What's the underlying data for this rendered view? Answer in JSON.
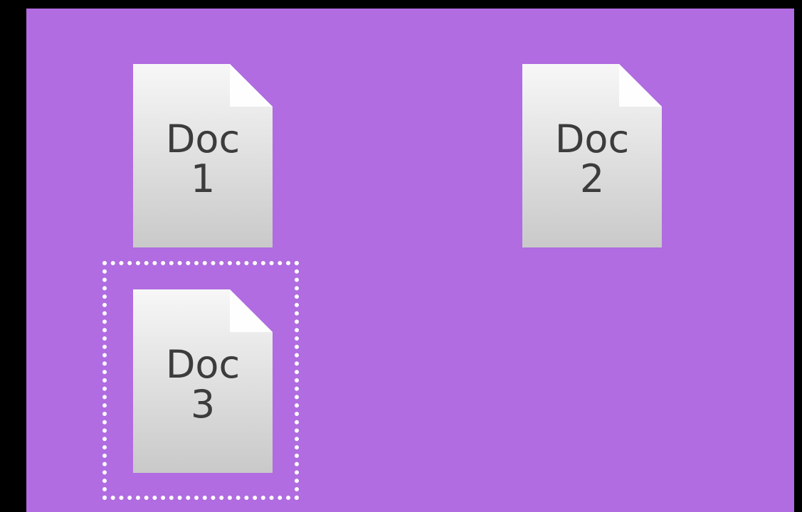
{
  "colors": {
    "background": "#000000",
    "desktop": "#b06ce0",
    "file_page_top": "#f7f7f7",
    "file_page_bottom": "#c9c9c9",
    "label_text": "#3c3c3c",
    "selection": "#ffffff"
  },
  "files": [
    {
      "name": "document-icon",
      "line1": "Doc",
      "line2": "1",
      "selected": false
    },
    {
      "name": "document-icon",
      "line1": "Doc",
      "line2": "2",
      "selected": false
    },
    {
      "name": "document-icon",
      "line1": "Doc",
      "line2": "3",
      "selected": true
    }
  ]
}
